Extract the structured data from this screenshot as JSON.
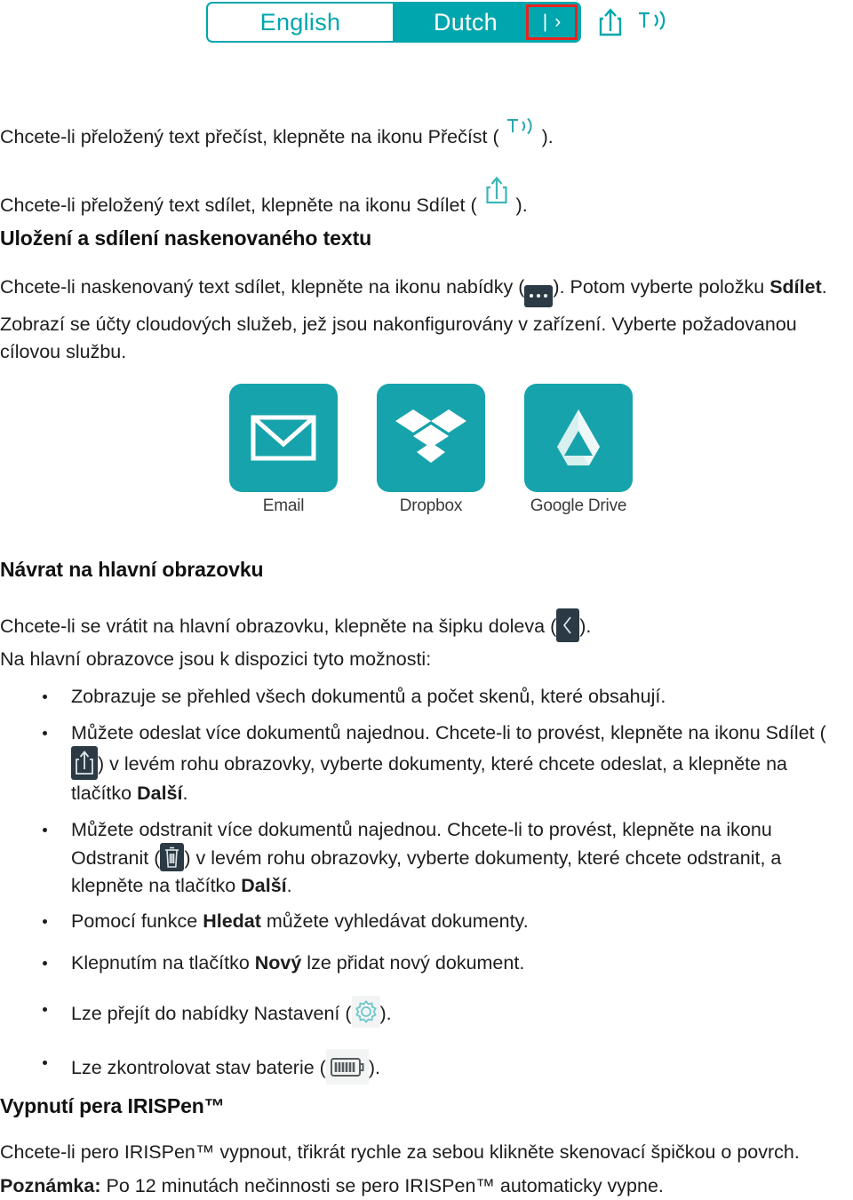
{
  "language_bar": {
    "source_language": "English",
    "target_language": "Dutch",
    "go_separator": "|",
    "go_arrow": "›",
    "share_icon_name": "share-icon",
    "tts_icon_name": "text-to-speech-icon",
    "highlight_color": "#e8231f",
    "accent_color": "#00a6ad"
  },
  "intro": {
    "read_line_before": "Chcete-li přeložený text přečíst, klepněte na ikonu Přečíst ( ",
    "read_line_after": " ).",
    "share_line_before": "Chcete-li přeložený text sdílet, klepněte na ikonu Sdílet ( ",
    "share_line_after": " )."
  },
  "save_share_section": {
    "heading": "Uložení a sdílení naskenovaného textu",
    "p1_before": "Chcete-li naskenovaný text sdílet, klepněte na ikonu nabídky (",
    "p1_mid": "). Potom vyberte položku ",
    "p1_bold": "Sdílet",
    "p1_end": ".",
    "p2": "Zobrazí se účty cloudových služeb, jež jsou nakonfigurovány v zařízení. Vyberte požadovanou cílovou službu.",
    "services": [
      {
        "label": "Email",
        "icon": "envelope-icon"
      },
      {
        "label": "Dropbox",
        "icon": "dropbox-icon"
      },
      {
        "label": "Google Drive",
        "icon": "google-drive-icon"
      }
    ]
  },
  "home_section": {
    "heading": "Návrat na hlavní obrazovku",
    "p1_before": "Chcete-li se vrátit na hlavní obrazovku, klepněte na šipku doleva (",
    "p1_after": ").",
    "p2": "Na hlavní obrazovce jsou k dispozici tyto možnosti:",
    "bullets": [
      {
        "id": "overview",
        "text": "Zobrazuje se přehled všech dokumentů a počet skenů, které obsahují."
      },
      {
        "id": "send-multiple",
        "before": "Můžete odeslat více dokumentů najednou. Chcete-li to provést, klepněte na ikonu Sdílet (",
        "after": ") v levém rohu obrazovky, vyberte dokumenty, které chcete odeslat, a klepněte na tlačítko ",
        "bold": "Další",
        "end": ".",
        "icon": "share-icon"
      },
      {
        "id": "delete-multiple",
        "before": "Můžete odstranit více dokumentů najednou. Chcete-li to provést, klepněte na ikonu Odstranit (",
        "after": ") v levém rohu obrazovky, vyberte dokumenty, které chcete odstranit, a klepněte na tlačítko ",
        "bold": "Další",
        "end": ".",
        "icon": "trash-icon"
      },
      {
        "id": "search",
        "before": "Pomocí funkce ",
        "bold": "Hledat",
        "after": " můžete vyhledávat dokumenty."
      },
      {
        "id": "new",
        "before": "Klepnutím na tlačítko ",
        "bold": "Nový",
        "after": " lze přidat nový dokument."
      },
      {
        "id": "settings",
        "before": "Lze přejít do nabídky Nastavení (",
        "after": ").",
        "icon": "gear-icon"
      },
      {
        "id": "battery",
        "before": "Lze zkontrolovat stav baterie (",
        "after": ").",
        "icon": "battery-icon"
      }
    ]
  },
  "shutdown_section": {
    "heading": "Vypnutí pera IRISPen™",
    "p1": "Chcete-li pero IRISPen™ vypnout, třikrát rychle za sebou klikněte skenovací špičkou o povrch.",
    "note_label": "Poznámka:",
    "note_text": " Po 12 minutách nečinnosti se pero IRISPen™ automaticky vypne."
  }
}
